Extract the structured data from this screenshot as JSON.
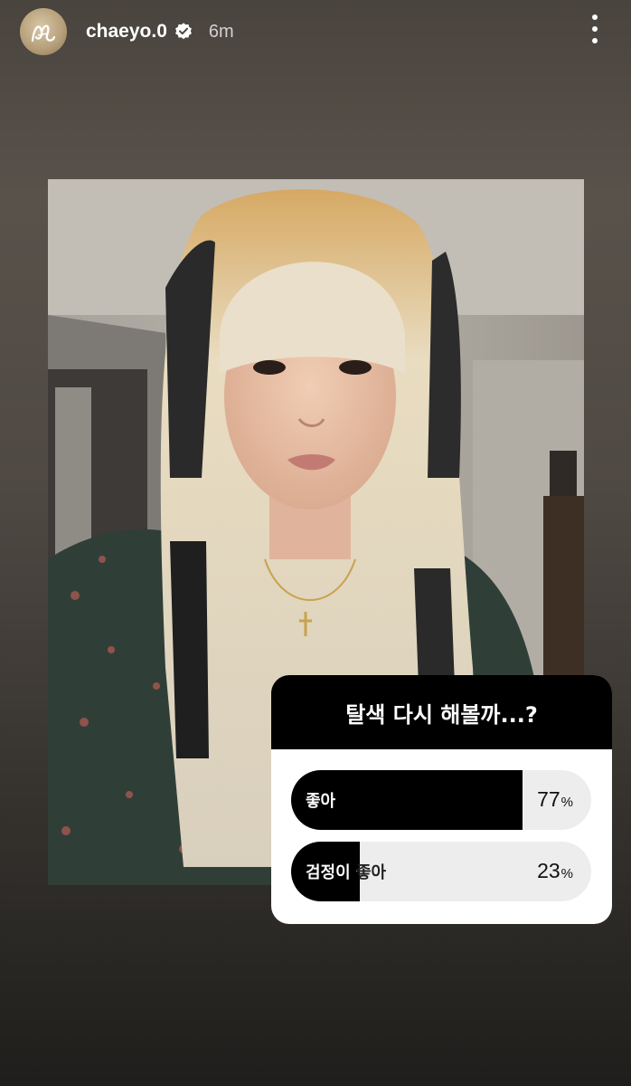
{
  "story": {
    "username": "chaeyo.0",
    "time": "6m",
    "verified": true,
    "avatar_icon": "avatar-icon",
    "menu_icon": "more-vertical-icon"
  },
  "poll": {
    "question": "탈색 다시 해볼까...?",
    "options": [
      {
        "label": "좋아",
        "percent": "77",
        "unit": "%",
        "share": 0.77
      },
      {
        "label": "검정이 좋아",
        "percent": "23",
        "unit": "%",
        "share": 0.23
      }
    ]
  },
  "colors": {
    "poll_fill": "#000000",
    "poll_track": "#ededed",
    "verified_badge": "#ffffff"
  }
}
